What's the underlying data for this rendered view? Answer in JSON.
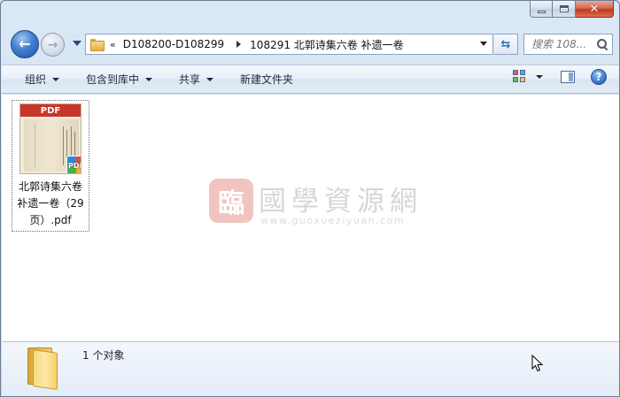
{
  "window": {
    "caption_buttons": {
      "minimize_icon": "minimize-icon",
      "maximize_icon": "maximize-icon",
      "close_glyph": "✕"
    }
  },
  "nav": {
    "back_glyph": "←",
    "forward_glyph": "→",
    "address": {
      "overflow": "«",
      "crumbs": [
        "D108200-D108299",
        "108291 北郭诗集六卷 补遗一卷"
      ]
    },
    "refresh_glyph": "⇆",
    "search": {
      "placeholder": "搜索 108..."
    }
  },
  "toolbar": {
    "organize": "组织",
    "include_in_library": "包含到库中",
    "share": "共享",
    "new_folder": "新建文件夹",
    "help_glyph": "?"
  },
  "files": [
    {
      "name": "北郭诗集六卷 补遗一卷（29页）.pdf",
      "thumb_label": "PDF",
      "badge_label": "PDF"
    }
  ],
  "watermark": {
    "seal": "臨",
    "title": "國學資源網",
    "url": "www.guoxueziyuan.com"
  },
  "details": {
    "count": "1 个对象"
  },
  "colors": {
    "accent": "#2f6fc5",
    "pdf_band": "#c8352b",
    "window_frame": "#cfdceb"
  }
}
